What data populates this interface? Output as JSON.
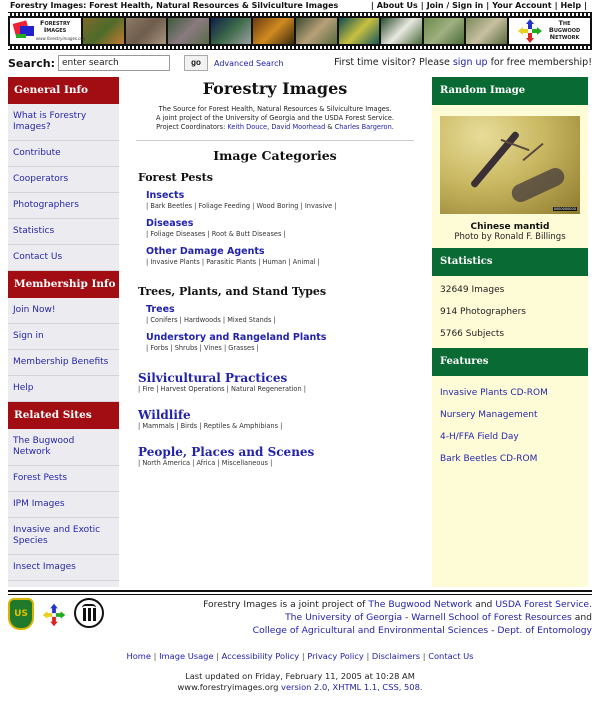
{
  "header": {
    "site_title": "Forestry Images: Forest Health, Natural Resources & Silviculture Images",
    "topnav": [
      "About Us",
      "Join / Sign in",
      "Your Account",
      "Help"
    ],
    "logo_text": [
      "Forestry",
      "Images"
    ],
    "logo_url_text": "www.forestryimages.org",
    "partner_logo_text": [
      "The",
      "Bugwood",
      "Network"
    ],
    "film_frames": [
      {
        "name": "orange-foliage",
        "colors": [
          "#7d6a2a",
          "#4e6b2b",
          "#c07a30"
        ]
      },
      {
        "name": "bark-moth",
        "colors": [
          "#8c7a66",
          "#6e5c4c",
          "#a89680"
        ]
      },
      {
        "name": "pine-cone",
        "colors": [
          "#3d5a3a",
          "#8a7a80",
          "#5a6a4a"
        ]
      },
      {
        "name": "lizard",
        "colors": [
          "#0e1e4a",
          "#3e6a4a",
          "#9aa0a0"
        ]
      },
      {
        "name": "fire",
        "colors": [
          "#6a3a10",
          "#d08a20",
          "#3a2a10"
        ]
      },
      {
        "name": "bird",
        "colors": [
          "#3a4a30",
          "#b8a078",
          "#5a6a40"
        ]
      },
      {
        "name": "caterpillars",
        "colors": [
          "#0e4a50",
          "#c8c040",
          "#1a5a5a"
        ]
      },
      {
        "name": "white-flowers",
        "colors": [
          "#2a4a2a",
          "#e8e8e0",
          "#4a6a3a"
        ]
      },
      {
        "name": "meadow",
        "colors": [
          "#6a8a4a",
          "#a0b080",
          "#4a6a3a"
        ]
      },
      {
        "name": "fungus",
        "colors": [
          "#7a8a5a",
          "#c8c0a0",
          "#5a6a40"
        ]
      }
    ]
  },
  "search": {
    "label": "Search:",
    "value": "enter search",
    "go_label": "go",
    "advanced_label": "Advanced Search",
    "first_time_pre": "First time visitor? Please ",
    "first_time_link": "sign up",
    "first_time_post": " for free membership!"
  },
  "sidebar": {
    "sections": [
      {
        "title": "General Info",
        "items": [
          "What is Forestry Images?",
          "Contribute",
          "Cooperators",
          "Photographers",
          "Statistics",
          "Contact Us"
        ]
      },
      {
        "title": "Membership Info",
        "items": [
          "Join Now!",
          "Sign in",
          "Membership Benefits",
          "Help"
        ]
      },
      {
        "title": "Related Sites",
        "items": [
          "The Bugwood Network",
          "Forest Pests",
          "IPM Images",
          "Invasive and Exotic Species",
          "Insect Images"
        ]
      }
    ]
  },
  "main": {
    "title": "Forestry Images",
    "intro_line1": "The Source for Forest Health, Natural Resources & Silviculture Images.",
    "intro_line2": "A joint project of the University of Georgia and the USDA Forest Service.",
    "coordinators_label": "Project Coordinators: ",
    "coordinators": [
      "Keith Douce",
      "David Moorhead",
      "Charles Bargeron"
    ],
    "categories_title": "Image Categories",
    "forest_pests": {
      "title": "Forest Pests",
      "subs": [
        {
          "title": "Insects",
          "links": [
            "Bark Beetles",
            "Foliage Feeding",
            "Wood Boring",
            "Invasive"
          ]
        },
        {
          "title": "Diseases",
          "links": [
            "Foliage Diseases",
            "Root & Butt Diseases"
          ]
        },
        {
          "title": "Other Damage Agents",
          "links": [
            "Invasive Plants",
            "Parasitic Plants",
            "Human",
            "Animal"
          ]
        }
      ]
    },
    "trees": {
      "title": "Trees, Plants, and Stand Types",
      "subs": [
        {
          "title": "Trees",
          "links": [
            "Conifers",
            "Hardwoods",
            "Mixed Stands"
          ]
        },
        {
          "title": "Understory and Rangeland Plants",
          "links": [
            "Forbs",
            "Shrubs",
            "Vines",
            "Grasses"
          ]
        }
      ]
    },
    "top_categories": [
      {
        "title": "Silvicultural Practices",
        "links": [
          "Fire",
          "Harvest Operations",
          "Natural Regeneration"
        ]
      },
      {
        "title": "Wildlife",
        "links": [
          "Mammals",
          "Birds",
          "Reptiles & Amphibians"
        ]
      },
      {
        "title": "People, Places and Scenes",
        "links": [
          "North America",
          "Africa",
          "Miscellaneous"
        ]
      }
    ]
  },
  "right": {
    "random_title": "Random Image",
    "random_caption": "Chinese mantid",
    "random_credit": "Photo by Ronald F. Billings",
    "random_image_id": "0000000000",
    "stats_title": "Statistics",
    "stats": [
      "32649 Images",
      "914 Photographers",
      "5766 Subjects"
    ],
    "features_title": "Features",
    "features": [
      "Invasive Plants CD-ROM",
      "Nursery Management",
      "4-H/FFA Field Day",
      "Bark Beetles CD-ROM"
    ]
  },
  "footer": {
    "usfs_logo_text": "US",
    "line1_pre": "Forestry Images is a joint project of ",
    "line1_link1": "The Bugwood Network",
    "line1_mid": " and ",
    "line1_link2": "USDA Forest Service",
    "line1_post": ".",
    "line2_link1": "The University of Georgia",
    "line2_sep": " - ",
    "line2_link2": "Warnell School of Forest Resources",
    "line2_post": " and",
    "line3_link1": "College of Agricultural and Environmental Sciences",
    "line3_sep": " - ",
    "line3_link2": "Dept. of Entomology",
    "links": [
      "Home",
      "Image Usage",
      "Accessibility Policy",
      "Privacy Policy",
      "Disclaimers",
      "Contact Us"
    ],
    "updated": "Last updated on Friday, February 11, 2005 at 10:28 AM",
    "site_url": "www.forestryimages.org",
    "tech_links": "version 2.0, XHTML 1.1, CSS, 508."
  },
  "colors": {
    "left_header": "#a10d12",
    "right_header": "#0a6a34",
    "link": "#2222aa",
    "right_bg": "#fefbd7",
    "left_bg": "#ebebf0"
  }
}
